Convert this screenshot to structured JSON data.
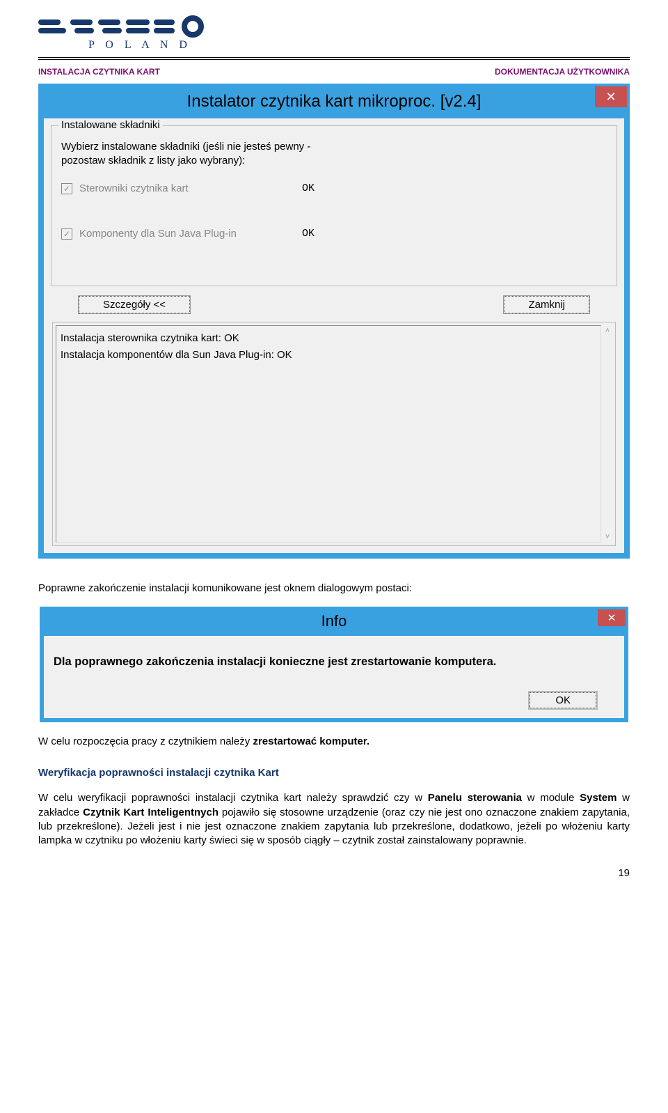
{
  "logo": {
    "brand": "asseco",
    "sub": "P O L A N D"
  },
  "docHead": {
    "left": "INSTALACJA CZYTNIKA KART",
    "right": "DOKUMENTACJA  UŻYTKOWNIKA"
  },
  "installer": {
    "title": "Instalator czytnika kart mikroproc. [v2.4]",
    "group_title": "Instalowane składniki",
    "intro_l1": "Wybierz instalowane składniki (jeśli nie jesteś pewny -",
    "intro_l2": "pozostaw składnik z listy jako wybrany):",
    "item1_label": "Sterowniki czytnika kart",
    "item1_status": "OK",
    "item2_label": "Komponenty dla Sun Java Plug-in",
    "item2_status": "OK",
    "btn_details": "Szczegóły <<",
    "btn_close": "Zamknij",
    "log_l1": "Instalacja sterownika czytnika kart: OK",
    "log_l2": "Instalacja komponentów dla Sun Java Plug-in: OK"
  },
  "text1": "Poprawne zakończenie instalacji komunikowane jest oknem dialogowym postaci:",
  "info": {
    "title": "Info",
    "msg": "Dla poprawnego zakończenia instalacji konieczne jest zrestartowanie komputera.",
    "ok": "OK"
  },
  "text2_a": "W celu rozpoczęcia pracy z czytnikiem należy ",
  "text2_b": "zrestartować komputer.",
  "section_title": "Weryfikacja poprawności instalacji czytnika Kart",
  "para_a": "W celu weryfikacji poprawności instalacji czytnika kart należy sprawdzić czy w ",
  "para_b": "Panelu sterowania",
  "para_c": " w module ",
  "para_d": "System",
  "para_e": " w zakładce ",
  "para_f": "Czytnik Kart Inteligentnych",
  "para_g": " pojawiło się stosowne urządzenie (oraz czy nie jest ono oznaczone znakiem zapytania, lub przekreślone). Jeżeli jest i nie jest oznaczone znakiem zapytania lub przekreślone, dodatkowo, jeżeli po włożeniu karty lampka w czytniku po włożeniu karty świeci się w sposób ciągły – czytnik został zainstalowany poprawnie.",
  "pageno": "19"
}
